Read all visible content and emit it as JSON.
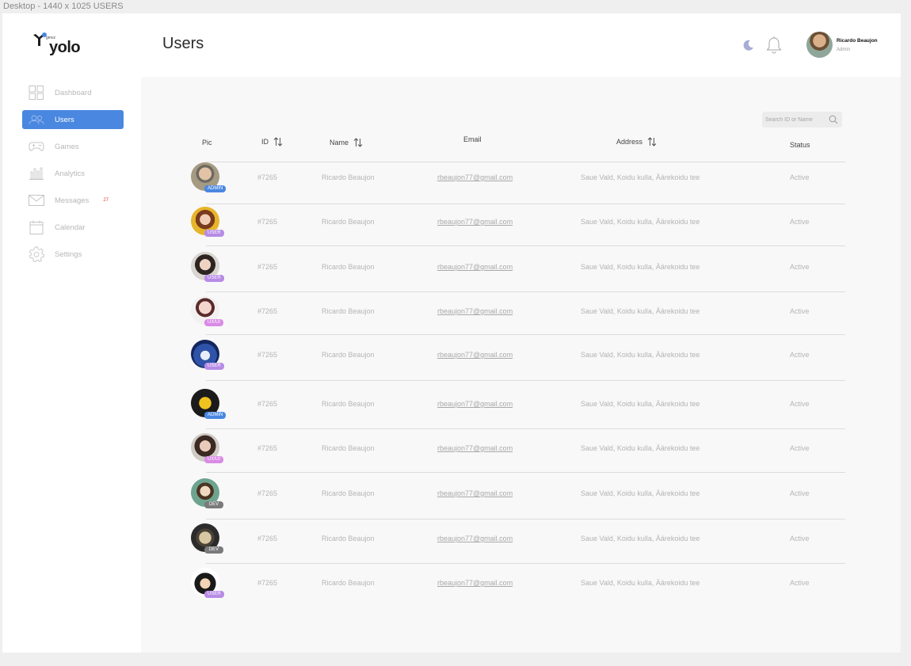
{
  "frame_label": "Desktop - 1440 x 1025 USERS",
  "brand": {
    "name": "yolo",
    "sub": "gmvz"
  },
  "header": {
    "title": "Users",
    "theme_icon": "moon-icon",
    "notif_icon": "bell-icon",
    "user": {
      "name": "Ricardo Beaujon",
      "role": "Admin"
    }
  },
  "sidebar": {
    "items": [
      {
        "label": "Dashboard",
        "icon": "grid-icon",
        "active": false
      },
      {
        "label": "Users",
        "icon": "users-icon",
        "active": true
      },
      {
        "label": "Games",
        "icon": "gamepad-icon",
        "active": false
      },
      {
        "label": "Analytics",
        "icon": "bar-chart-icon",
        "active": false
      },
      {
        "label": "Messages",
        "icon": "envelope-icon",
        "active": false,
        "badge": "27"
      },
      {
        "label": "Calendar",
        "icon": "calendar-icon",
        "active": false
      },
      {
        "label": "Settings",
        "icon": "gear-icon",
        "active": false
      }
    ]
  },
  "search": {
    "placeholder": "Search ID or Name"
  },
  "table": {
    "columns": [
      {
        "label": "Pic",
        "sortable": false
      },
      {
        "label": "ID",
        "sortable": true
      },
      {
        "label": "Name",
        "sortable": true
      },
      {
        "label": "Email",
        "sortable": false
      },
      {
        "label": "Address",
        "sortable": true
      },
      {
        "label": "Status",
        "sortable": false
      }
    ],
    "rows": [
      {
        "role": "ADMIN",
        "id": "#7265",
        "name": "Ricardo Beaujon",
        "email": "rbeaujon77@gmail.com",
        "address": "Saue Vald, Koidu kulla, Äärekoidu tee",
        "status": "Active"
      },
      {
        "role": "USER",
        "id": "#7265",
        "name": "Ricardo Beaujon",
        "email": "rbeaujon77@gmail.com",
        "address": "Saue Vald, Koidu kulla, Äärekoidu tee",
        "status": "Active"
      },
      {
        "role": "USER",
        "id": "#7265",
        "name": "Ricardo Beaujon",
        "email": "rbeaujon77@gmail.com",
        "address": "Saue Vald, Koidu kulla, Äärekoidu tee",
        "status": "Active"
      },
      {
        "role": "UX/UI",
        "id": "#7265",
        "name": "Ricardo Beaujon",
        "email": "rbeaujon77@gmail.com",
        "address": "Saue Vald, Koidu kulla, Äärekoidu tee",
        "status": "Active"
      },
      {
        "role": "USER",
        "id": "#7265",
        "name": "Ricardo Beaujon",
        "email": "rbeaujon77@gmail.com",
        "address": "Saue Vald, Koidu kulla, Äärekoidu tee",
        "status": "Active"
      },
      {
        "role": "ADMIN",
        "id": "#7265",
        "name": "Ricardo Beaujon",
        "email": "rbeaujon77@gmail.com",
        "address": "Saue Vald, Koidu kulla, Äärekoidu tee",
        "status": "Active"
      },
      {
        "role": "UX/UI",
        "id": "#7265",
        "name": "Ricardo Beaujon",
        "email": "rbeaujon77@gmail.com",
        "address": "Saue Vald, Koidu kulla, Äärekoidu tee",
        "status": "Active"
      },
      {
        "role": "DEV",
        "id": "#7265",
        "name": "Ricardo Beaujon",
        "email": "rbeaujon77@gmail.com",
        "address": "Saue Vald, Koidu kulla, Äärekoidu tee",
        "status": "Active"
      },
      {
        "role": "DEV",
        "id": "#7265",
        "name": "Ricardo Beaujon",
        "email": "rbeaujon77@gmail.com",
        "address": "Saue Vald, Koidu kulla, Äärekoidu tee",
        "status": "Active"
      },
      {
        "role": "USER",
        "id": "#7265",
        "name": "Ricardo Beaujon",
        "email": "rbeaujon77@gmail.com",
        "address": "Saue Vald, Koidu kulla, Äärekoidu tee",
        "status": "Active"
      }
    ]
  },
  "colors": {
    "accent": "#4a87e0",
    "badge_admin": "#4a87e0",
    "badge_user": "#b78be6",
    "badge_uxui": "#d98be6",
    "badge_dev": "#7a7a7a",
    "messages_badge": "#e0463b"
  }
}
